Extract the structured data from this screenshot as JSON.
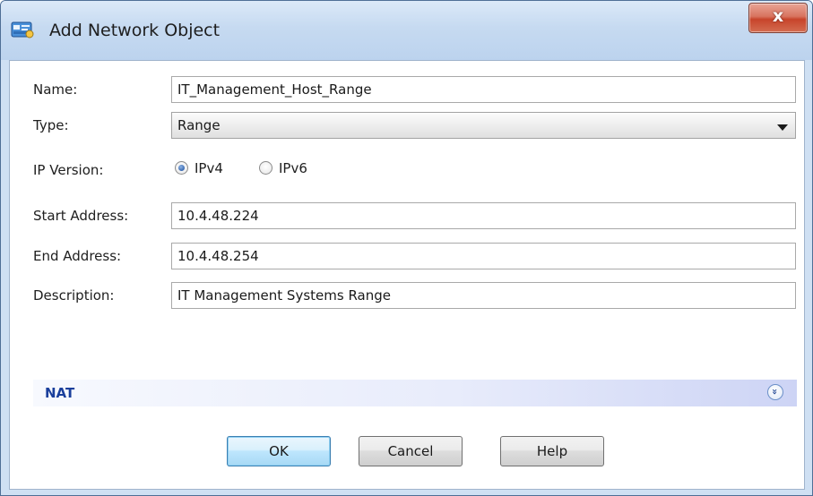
{
  "window": {
    "title": "Add Network Object",
    "close_glyph": "x"
  },
  "form": {
    "name_label": "Name:",
    "name_value": "IT_Management_Host_Range",
    "type_label": "Type:",
    "type_value": "Range",
    "ip_version_label": "IP Version:",
    "ip_version_options": [
      "IPv4",
      "IPv6"
    ],
    "ip_version_selected": "IPv4",
    "start_label": "Start Address:",
    "start_value": "10.4.48.224",
    "end_label": "End Address:",
    "end_value": "10.4.48.254",
    "description_label": "Description:",
    "description_value": "IT Management Systems Range"
  },
  "nat": {
    "label": "NAT",
    "toggle_glyph": "»"
  },
  "buttons": {
    "ok": "OK",
    "cancel": "Cancel",
    "help": "Help"
  },
  "icons": {
    "app": "network-object-icon",
    "close": "close-icon",
    "dropdown": "chevron-down-icon",
    "expand": "expand-icon"
  },
  "colors": {
    "title_bar": "#c6daf1",
    "close_button": "#c7442b",
    "nat_text": "#1a3f9c",
    "default_button_border": "#3c7fb1"
  }
}
